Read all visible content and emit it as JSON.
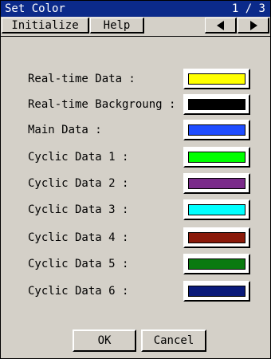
{
  "window": {
    "title": "Set Color",
    "page_indicator": "1 / 3"
  },
  "toolbar": {
    "initialize_label": "Initialize",
    "help_label": "Help",
    "prev_icon": "left-arrow",
    "next_icon": "right-arrow"
  },
  "rows": [
    {
      "label": "Real-time Data :",
      "color": "#ffff00"
    },
    {
      "label": "Real-time Backgroung :",
      "color": "#000000"
    },
    {
      "label": "Main Data :",
      "color": "#1e4cff"
    },
    {
      "label": "Cyclic Data 1 :",
      "color": "#00ff00"
    },
    {
      "label": "Cyclic Data 2 :",
      "color": "#7a2a8a"
    },
    {
      "label": "Cyclic Data 3 :",
      "color": "#00ffff"
    },
    {
      "label": "Cyclic Data 4 :",
      "color": "#8a1a0a"
    },
    {
      "label": "Cyclic Data 5 :",
      "color": "#0a7a10"
    },
    {
      "label": "Cyclic Data 6 :",
      "color": "#0a1a7a"
    }
  ],
  "footer": {
    "ok_label": "OK",
    "cancel_label": "Cancel"
  }
}
